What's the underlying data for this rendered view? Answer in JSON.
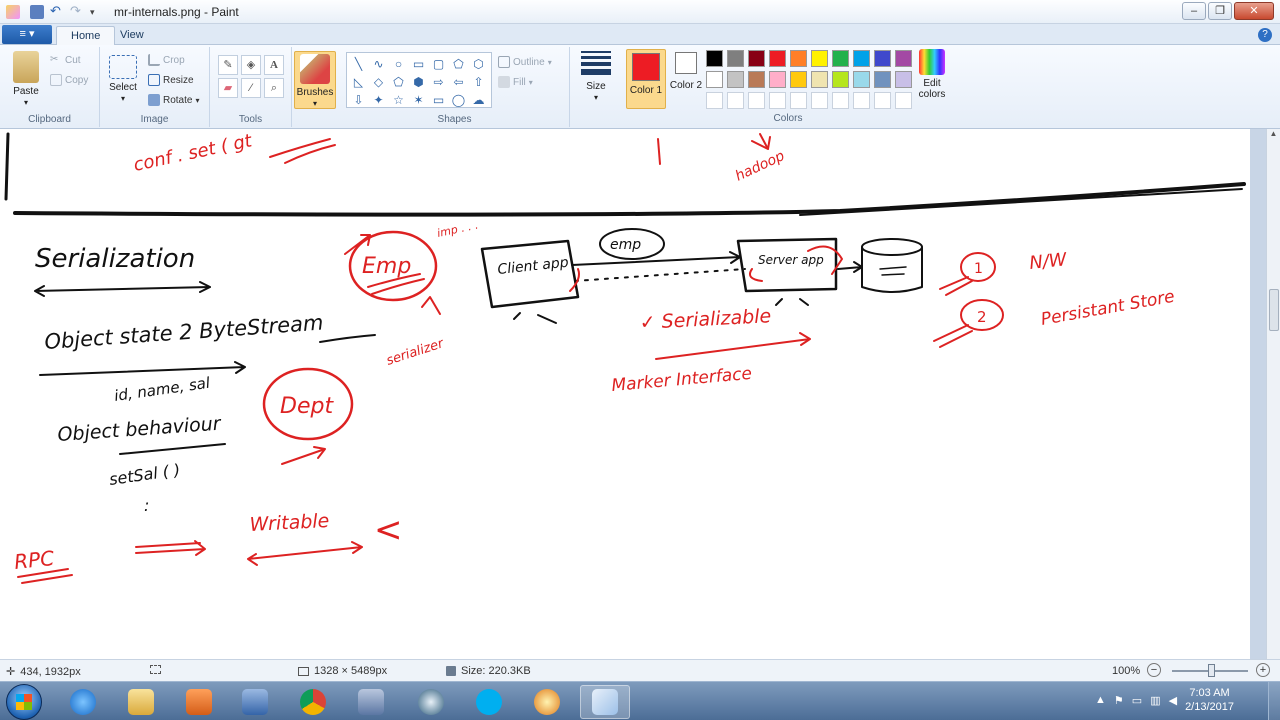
{
  "window": {
    "title": "mr-internals.png - Paint",
    "buttons": [
      "–",
      "❐",
      "✕"
    ]
  },
  "ribbon_tabs": {
    "file": "≡ ▾",
    "home": "Home",
    "view": "View"
  },
  "clipboard": {
    "paste": "Paste",
    "cut": "Cut",
    "copy": "Copy",
    "label": "Clipboard"
  },
  "image": {
    "select": "Select",
    "crop": "Crop",
    "resize": "Resize",
    "rotate": "Rotate",
    "label": "Image"
  },
  "tools": {
    "label": "Tools"
  },
  "brushes": {
    "label": "Brushes"
  },
  "shapes": {
    "label": "Shapes",
    "outline": "Outline",
    "fill": "Fill",
    "glyphs": [
      "╲",
      "∿",
      "○",
      "▭",
      "▢",
      "⬠",
      "⬡",
      "◺",
      "◇",
      "⬠",
      "⬢",
      "⇨",
      "⇦",
      "⇧",
      "⇩",
      "✦",
      "☆",
      "✶",
      "▭",
      "◯",
      "☁"
    ]
  },
  "size": {
    "label": "Size"
  },
  "color1": {
    "label": "Color 1"
  },
  "color2": {
    "label": "Color 2"
  },
  "colors": {
    "label": "Colors",
    "edit": "Edit colors",
    "palette": [
      "#000000",
      "#7f7f7f",
      "#880015",
      "#ed1c24",
      "#ff7f27",
      "#fff200",
      "#22b14c",
      "#00a2e8",
      "#3f48cc",
      "#a349a4",
      "#ffffff",
      "#c3c3c3",
      "#b97a57",
      "#ffaec9",
      "#ffc90e",
      "#efe4b0",
      "#b5e61d",
      "#99d9ea",
      "#7092be",
      "#c8bfe7",
      "#ffffff",
      "#ffffff",
      "#ffffff",
      "#ffffff",
      "#ffffff",
      "#ffffff",
      "#ffffff",
      "#ffffff",
      "#ffffff",
      "#ffffff"
    ]
  },
  "canvas": {
    "notes": {
      "conf": "conf . set ( gt",
      "hadoop": "hadoop",
      "serialization": "Serialization",
      "object_state": "Object state 2 ByteStream",
      "fields": "id, name, sal",
      "object_behaviour": "Object behaviour",
      "setsal": "setSal ( )",
      "colon": ":",
      "rpc": "RPC",
      "emp": "Emp",
      "dept": "Dept",
      "serializer": "serializer",
      "client_app": "Client app",
      "emp_small": "emp",
      "server_app": "Server app",
      "serializable": "✓ Serializable",
      "marker_interface": "Marker Interface",
      "writable": "Writable",
      "one": "1",
      "two": "2",
      "nw": "N/W",
      "persistent": "Persistant Store",
      "bracket": "<",
      "imp": "imp . . ."
    }
  },
  "status": {
    "cursor": "434, 1932px",
    "selection": "",
    "dimensions": "1328 × 5489px",
    "size": "Size: 220.3KB",
    "zoom": "100%"
  },
  "taskbar": {
    "time": "7:03 AM",
    "date": "2/13/2017"
  }
}
